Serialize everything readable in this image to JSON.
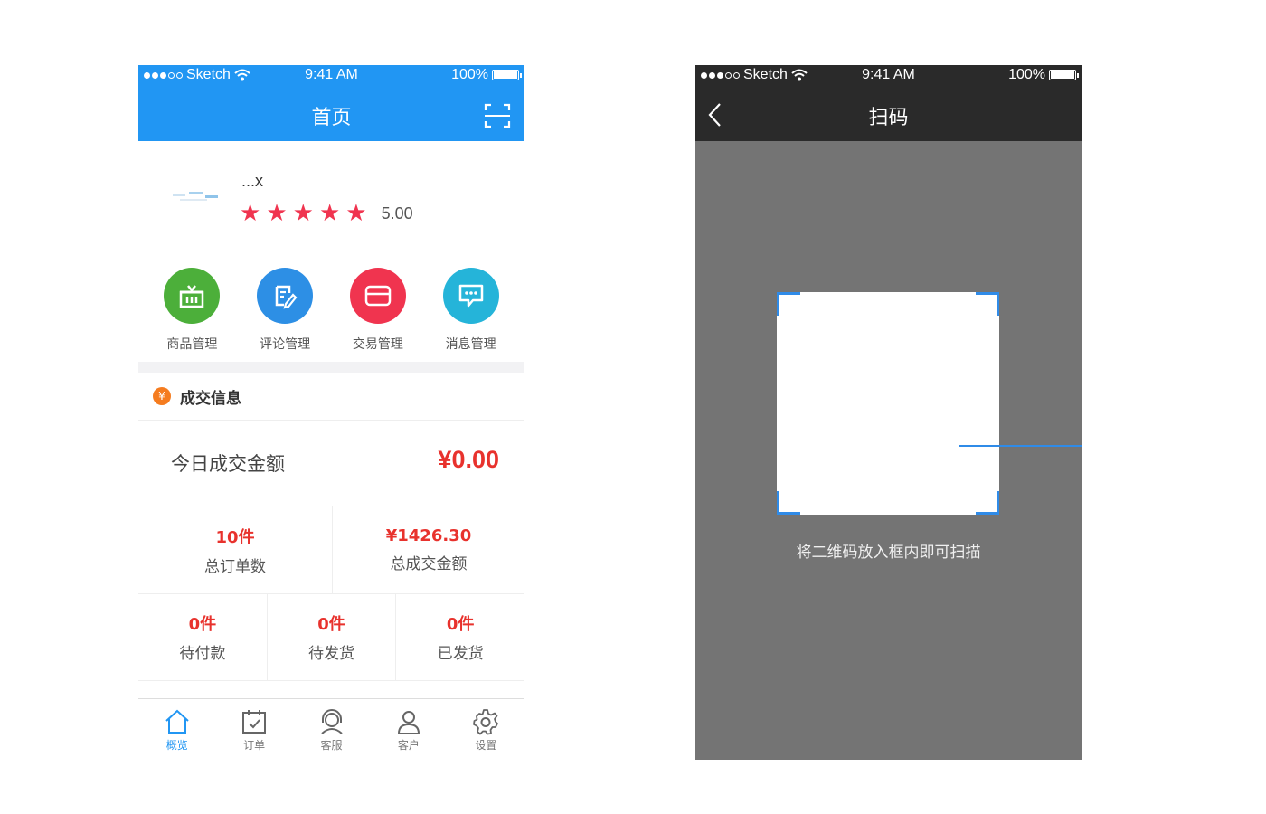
{
  "status_bar": {
    "carrier": "Sketch",
    "time": "9:41 AM",
    "battery": "100%"
  },
  "home": {
    "title": "首页",
    "shop": {
      "name": "...x",
      "rating": "5.00",
      "stars": 5
    },
    "quick_actions": [
      {
        "label": "商品管理",
        "icon": "basket-icon",
        "color": "#4caf3a"
      },
      {
        "label": "评论管理",
        "icon": "edit-note-icon",
        "color": "#2d8fe5"
      },
      {
        "label": "交易管理",
        "icon": "card-icon",
        "color": "#f0344f"
      },
      {
        "label": "消息管理",
        "icon": "chat-icon",
        "color": "#25b4d9"
      }
    ],
    "section": {
      "title": "成交信息",
      "icon_glyph": "¥"
    },
    "today": {
      "label": "今日成交金额",
      "value": "¥0.00"
    },
    "stats_row1": [
      {
        "value": "10件",
        "label": "总订单数"
      },
      {
        "value": "¥1426.30",
        "label": "总成交金额"
      }
    ],
    "stats_row2": [
      {
        "value": "0件",
        "label": "待付款"
      },
      {
        "value": "0件",
        "label": "待发货"
      },
      {
        "value": "0件",
        "label": "已发货"
      }
    ],
    "tabs": [
      {
        "label": "概览",
        "icon": "home-icon",
        "active": true
      },
      {
        "label": "订单",
        "icon": "calendar-check-icon",
        "active": false
      },
      {
        "label": "客服",
        "icon": "headset-icon",
        "active": false
      },
      {
        "label": "客户",
        "icon": "user-icon",
        "active": false
      },
      {
        "label": "设置",
        "icon": "gear-icon",
        "active": false
      }
    ]
  },
  "scan": {
    "title": "扫码",
    "hint": "将二维码放入框内即可扫描"
  },
  "colors": {
    "primary": "#2196f3",
    "accent_red": "#e8322d",
    "dark_header": "#2a2a2a",
    "scan_bg": "#747474",
    "scan_frame_corner": "#2f8be8"
  }
}
